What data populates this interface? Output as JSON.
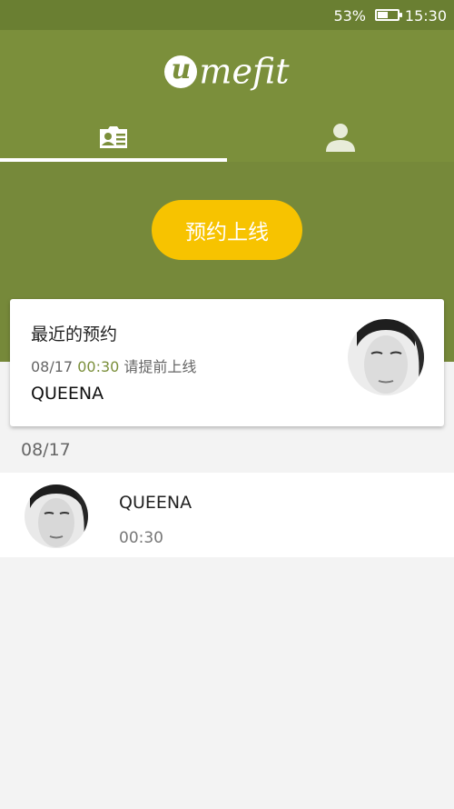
{
  "status_bar": {
    "battery_percent": "53%",
    "battery_level": 0.53,
    "time": "15:30"
  },
  "header": {
    "logo": {
      "mark": "u",
      "word": "mefit"
    },
    "tabs": [
      {
        "icon": "contact-card-icon",
        "active": true
      },
      {
        "icon": "person-icon",
        "active": false
      }
    ]
  },
  "book_button_label": "预约上线",
  "recent": {
    "title": "最近的预约",
    "date": "08/17",
    "time": "00:30",
    "note": "请提前上线",
    "name": "QUEENA"
  },
  "list": {
    "date_heading": "08/17",
    "items": [
      {
        "name": "QUEENA",
        "time": "00:30"
      }
    ]
  },
  "colors": {
    "header_green": "#7b8f3b",
    "status_green": "#6a7f32",
    "accent_yellow": "#f7c300"
  }
}
